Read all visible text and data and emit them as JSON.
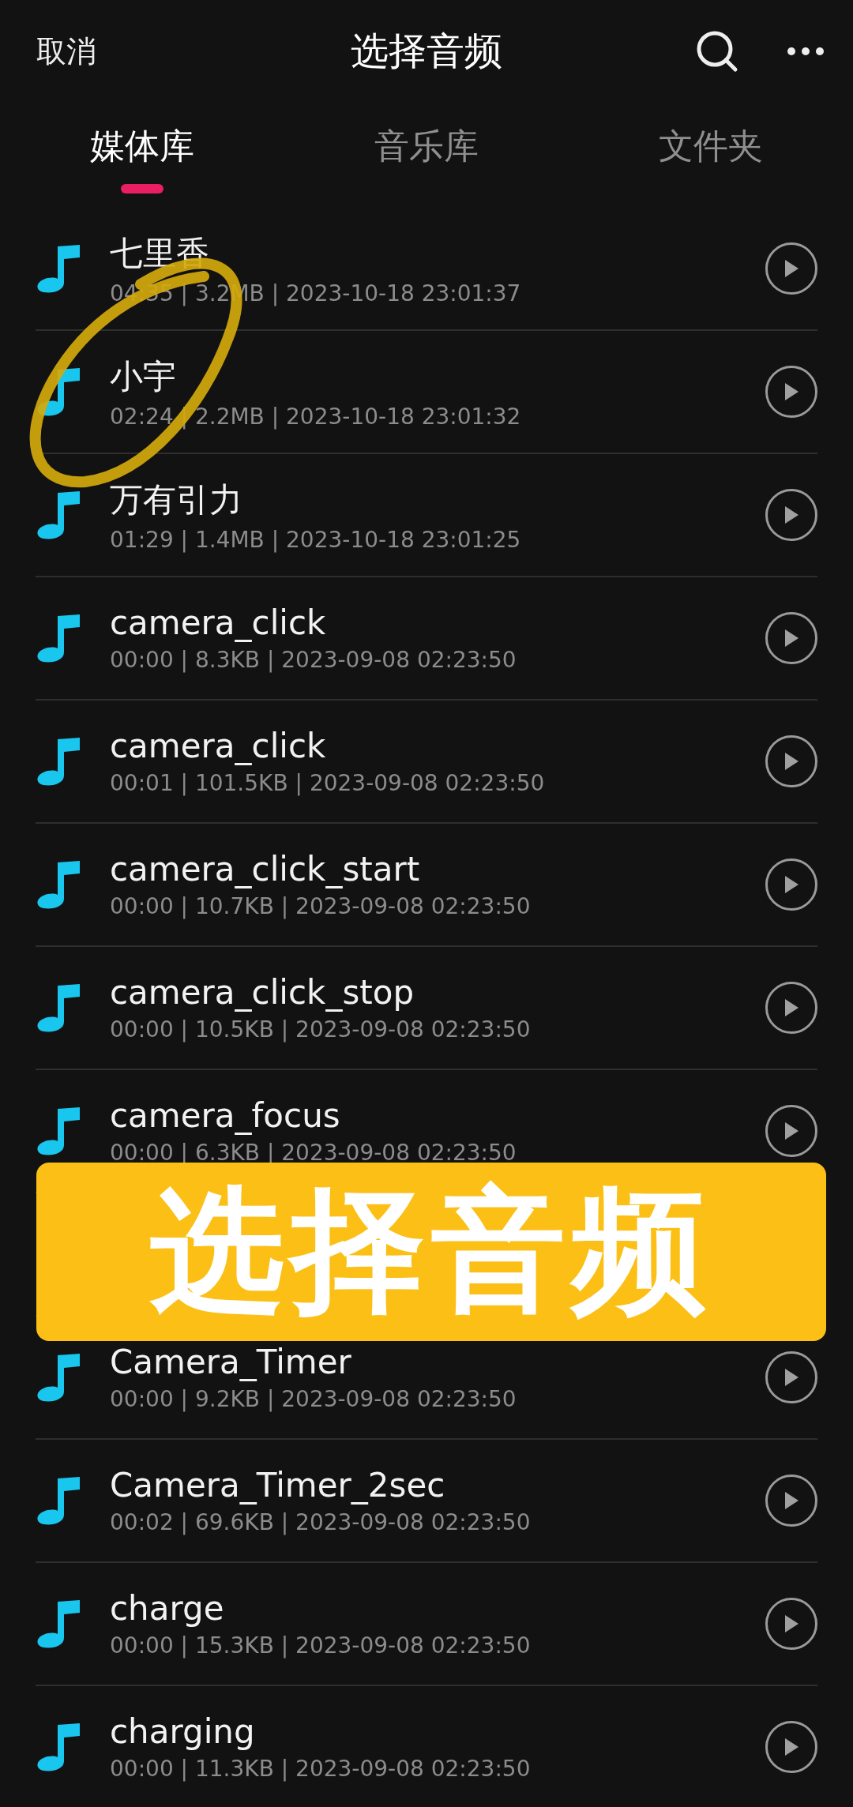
{
  "header": {
    "cancel": "取消",
    "title": "选择音频"
  },
  "tabs": [
    {
      "label": "媒体库",
      "selected": true
    },
    {
      "label": "音乐库",
      "selected": false
    },
    {
      "label": "文件夹",
      "selected": false
    }
  ],
  "tracks": [
    {
      "kind": "track",
      "title": "七里香",
      "details": "04:35 | 3.2MB | 2023-10-18 23:01:37"
    },
    {
      "kind": "track",
      "title": "小宇",
      "details": "02:24 | 2.2MB | 2023-10-18 23:01:32"
    },
    {
      "kind": "track",
      "title": "万有引力",
      "details": "01:29 | 1.4MB | 2023-10-18 23:01:25"
    },
    {
      "kind": "track",
      "title": "camera_click",
      "details": "00:00 | 8.3KB | 2023-09-08 02:23:50"
    },
    {
      "kind": "track",
      "title": "camera_click",
      "details": "00:01 | 101.5KB | 2023-09-08 02:23:50"
    },
    {
      "kind": "track",
      "title": "camera_click_start",
      "details": "00:00 | 10.7KB | 2023-09-08 02:23:50"
    },
    {
      "kind": "track",
      "title": "camera_click_stop",
      "details": "00:00 | 10.5KB | 2023-09-08 02:23:50"
    },
    {
      "kind": "track",
      "title": "camera_focus",
      "details": "00:00 | 6.3KB | 2023-09-08 02:23:50"
    },
    {
      "kind": "covered"
    },
    {
      "kind": "track",
      "title": "Camera_Timer",
      "details": "00:00 | 9.2KB | 2023-09-08 02:23:50"
    },
    {
      "kind": "track",
      "title": "Camera_Timer_2sec",
      "details": "00:02 | 69.6KB | 2023-09-08 02:23:50"
    },
    {
      "kind": "track",
      "title": "charge",
      "details": "00:00 | 15.3KB | 2023-09-08 02:23:50"
    },
    {
      "kind": "track",
      "title": "charging",
      "details": "00:00 | 11.3KB | 2023-09-08 02:23:50"
    }
  ],
  "banner": {
    "text": "选择音频"
  }
}
